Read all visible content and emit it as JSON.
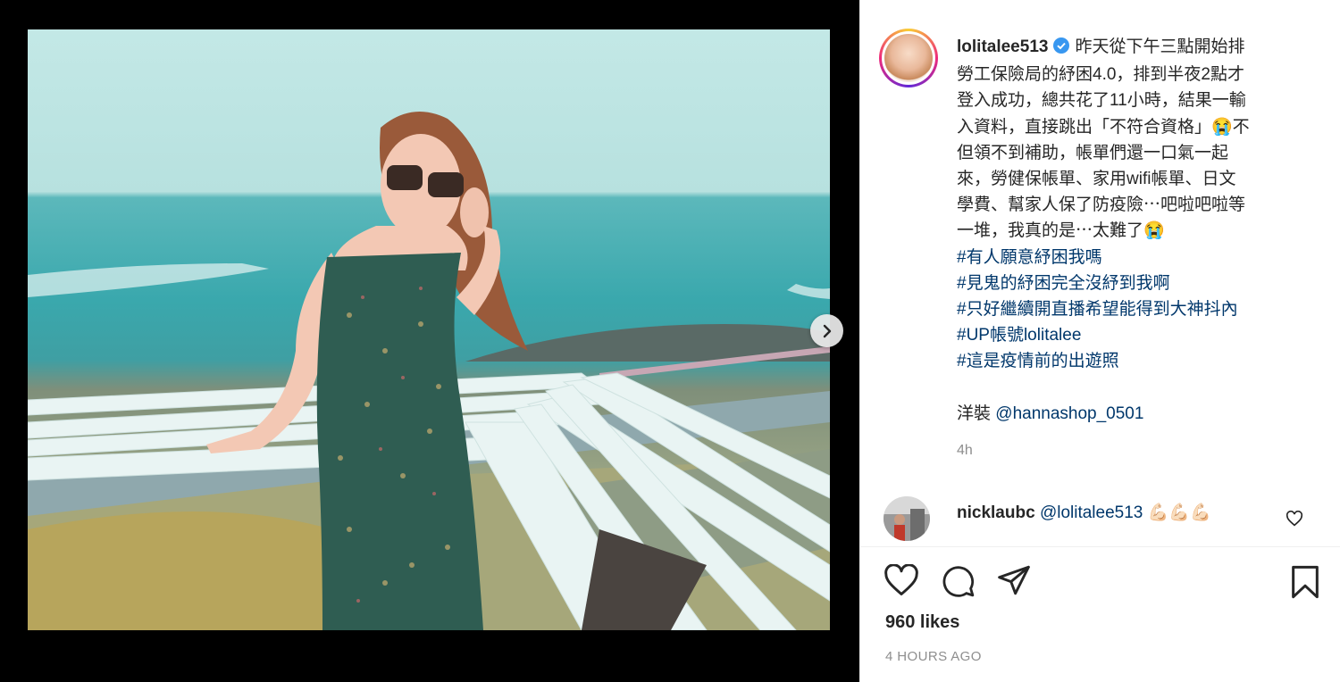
{
  "post": {
    "username": "lolitalee513",
    "caption_lines": [
      "昨天從下午三點開始排",
      "勞工保險局的紓困4.0，排到半夜2點才",
      "登入成功，總共花了11小時，結果一輸",
      "入資料，直接跳出「不符合資格」😭不",
      "但領不到補助，帳單們還一口氣一起",
      "來，勞健保帳單、家用wifi帳單、日文",
      "學費、幫家人保了防疫險⋯吧啦吧啦等",
      "一堆，我真的是⋯太難了😭"
    ],
    "hashtags": [
      "#有人願意紓困我嗎",
      "#見鬼的紓困完全沒紓到我啊",
      "#只好繼續開直播希望能得到大神抖內",
      "#UP帳號lolitalee",
      "#這是疫情前的出遊照"
    ],
    "outfit_prefix": "洋裝 ",
    "outfit_mention": "@hannashop_0501",
    "relative_time": "4h"
  },
  "comment": {
    "username": "nicklaubc",
    "mention": "@lolitalee513",
    "emoji": "💪🏻💪🏻💪🏻"
  },
  "stats": {
    "likes": "960 likes",
    "posted": "4 HOURS AGO"
  },
  "colors": {
    "link": "#00376b",
    "verified": "#3897f0",
    "muted": "#8e8e8e"
  },
  "icons": [
    "verified-badge-icon",
    "next-arrow-icon",
    "heart-icon",
    "comment-icon",
    "share-icon",
    "bookmark-icon",
    "comment-like-heart-icon"
  ]
}
